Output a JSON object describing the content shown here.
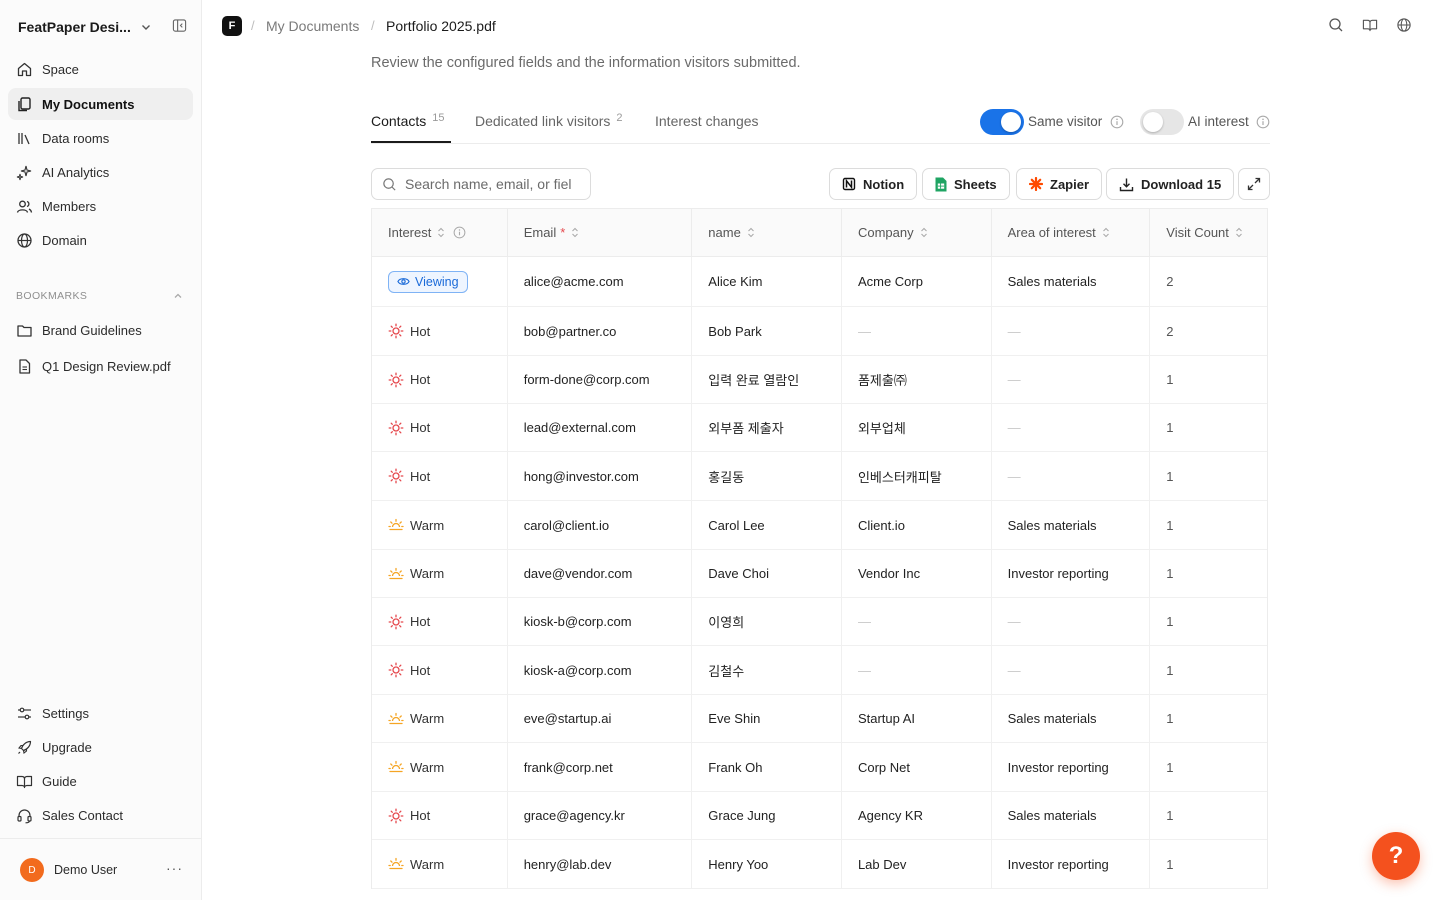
{
  "workspace": {
    "name": "FeatPaper Desi..."
  },
  "sidebar": {
    "items": [
      {
        "label": "Space",
        "icon": "home-icon"
      },
      {
        "label": "My Documents",
        "icon": "documents-icon",
        "active": true
      },
      {
        "label": "Data rooms",
        "icon": "library-icon"
      },
      {
        "label": "AI Analytics",
        "icon": "sparkles-icon"
      },
      {
        "label": "Members",
        "icon": "users-icon"
      },
      {
        "label": "Domain",
        "icon": "globe-icon"
      }
    ],
    "bookmarks_label": "BOOKMARKS",
    "bookmarks": [
      {
        "label": "Brand Guidelines",
        "icon": "folder-icon"
      },
      {
        "label": "Q1 Design Review.pdf",
        "icon": "file-icon"
      }
    ],
    "bottom_items": [
      {
        "label": "Settings",
        "icon": "sliders-icon"
      },
      {
        "label": "Upgrade",
        "icon": "rocket-icon"
      },
      {
        "label": "Guide",
        "icon": "book-icon"
      },
      {
        "label": "Sales Contact",
        "icon": "headset-icon"
      }
    ],
    "user": {
      "initial": "D",
      "name": "Demo User",
      "avatar_color": "#f26b1d"
    }
  },
  "header": {
    "logo": "F",
    "breadcrumb": [
      "My Documents",
      "Portfolio 2025.pdf"
    ],
    "description": "Review the configured fields and the information visitors submitted."
  },
  "tabs": [
    {
      "label": "Contacts",
      "count": "15",
      "active": true
    },
    {
      "label": "Dedicated link visitors",
      "count": "2"
    },
    {
      "label": "Interest changes",
      "count": ""
    }
  ],
  "toggles": {
    "same_visitor": {
      "label": "Same visitor",
      "on": true
    },
    "ai_interest": {
      "label": "AI interest",
      "on": false
    }
  },
  "toolbar": {
    "search_placeholder": "Search name, email, or fiel",
    "notion": "Notion",
    "sheets": "Sheets",
    "zapier": "Zapier",
    "download": "Download 15"
  },
  "table": {
    "columns": [
      "Interest",
      "Email",
      "name",
      "Company",
      "Area of interest",
      "Visit Count"
    ],
    "rows": [
      {
        "interest": "Viewing",
        "email": "alice@acme.com",
        "name": "Alice Kim",
        "company": "Acme Corp",
        "area": "Sales materials",
        "visits": "2"
      },
      {
        "interest": "Hot",
        "email": "bob@partner.co",
        "name": "Bob Park",
        "company": "—",
        "area": "—",
        "visits": "2"
      },
      {
        "interest": "Hot",
        "email": "form-done@corp.com",
        "name": "입력 완료 열람인",
        "company": "폼제출㈜",
        "area": "—",
        "visits": "1"
      },
      {
        "interest": "Hot",
        "email": "lead@external.com",
        "name": "외부폼 제출자",
        "company": "외부업체",
        "area": "—",
        "visits": "1"
      },
      {
        "interest": "Hot",
        "email": "hong@investor.com",
        "name": "홍길동",
        "company": "인베스터캐피탈",
        "area": "—",
        "visits": "1"
      },
      {
        "interest": "Warm",
        "email": "carol@client.io",
        "name": "Carol Lee",
        "company": "Client.io",
        "area": "Sales materials",
        "visits": "1"
      },
      {
        "interest": "Warm",
        "email": "dave@vendor.com",
        "name": "Dave Choi",
        "company": "Vendor Inc",
        "area": "Investor reporting",
        "visits": "1"
      },
      {
        "interest": "Hot",
        "email": "kiosk-b@corp.com",
        "name": "이영희",
        "company": "—",
        "area": "—",
        "visits": "1"
      },
      {
        "interest": "Hot",
        "email": "kiosk-a@corp.com",
        "name": "김철수",
        "company": "—",
        "area": "—",
        "visits": "1"
      },
      {
        "interest": "Warm",
        "email": "eve@startup.ai",
        "name": "Eve Shin",
        "company": "Startup AI",
        "area": "Sales materials",
        "visits": "1"
      },
      {
        "interest": "Warm",
        "email": "frank@corp.net",
        "name": "Frank Oh",
        "company": "Corp Net",
        "area": "Investor reporting",
        "visits": "1"
      },
      {
        "interest": "Hot",
        "email": "grace@agency.kr",
        "name": "Grace Jung",
        "company": "Agency KR",
        "area": "Sales materials",
        "visits": "1"
      },
      {
        "interest": "Warm",
        "email": "henry@lab.dev",
        "name": "Henry Yoo",
        "company": "Lab Dev",
        "area": "Investor reporting",
        "visits": "1"
      }
    ]
  },
  "help_button": "?",
  "colors": {
    "accent": "#1a73e8",
    "hot": "#e5484d",
    "warm": "#f5a524",
    "help": "#f4511e",
    "required": "#e5484d"
  }
}
